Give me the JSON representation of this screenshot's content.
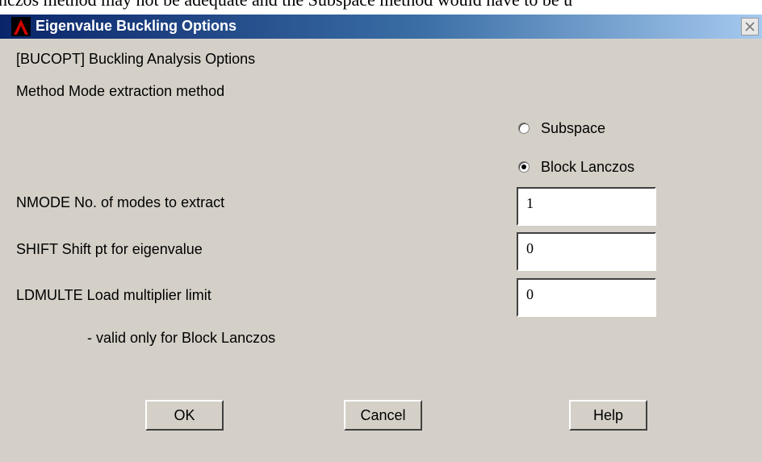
{
  "background_text": "nczos method may not be adequate and the Subspace method would have to be u",
  "window": {
    "title": "Eigenvalue Buckling Options",
    "title_gradient": [
      "#0a246a",
      "#a6caf0"
    ],
    "close_icon": "close-icon"
  },
  "header": {
    "command": "[BUCOPT]  Buckling Analysis Options",
    "method_label": "Method   Mode extraction method"
  },
  "method": {
    "options": [
      {
        "label": "Subspace",
        "checked": false
      },
      {
        "label": "Block Lanczos",
        "checked": true
      }
    ]
  },
  "fields": {
    "nmode": {
      "label": "NMODE    No. of modes to extract",
      "value": "1"
    },
    "shift": {
      "label": "SHIFT    Shift pt for eigenvalue",
      "value": "0"
    },
    "ldmulte": {
      "label": "LDMULTE  Load multiplier limit",
      "value": "0"
    },
    "note": "- valid only for Block Lanczos"
  },
  "buttons": {
    "ok": "OK",
    "cancel": "Cancel",
    "help": "Help"
  }
}
